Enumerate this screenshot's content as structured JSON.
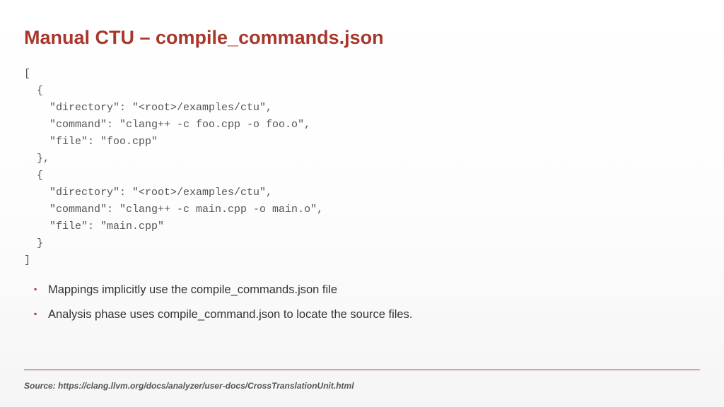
{
  "title": "Manual CTU – compile_commands.json",
  "code": "[\n  {\n    \"directory\": \"<root>/examples/ctu\",\n    \"command\": \"clang++ -c foo.cpp -o foo.o\",\n    \"file\": \"foo.cpp\"\n  },\n  {\n    \"directory\": \"<root>/examples/ctu\",\n    \"command\": \"clang++ -c main.cpp -o main.o\",\n    \"file\": \"main.cpp\"\n  }\n]",
  "bullets": [
    "Mappings implicitly use the compile_commands.json file",
    "Analysis phase uses compile_command.json to locate the source files."
  ],
  "source": "Source: https://clang.llvm.org/docs/analyzer/user-docs/CrossTranslationUnit.html"
}
